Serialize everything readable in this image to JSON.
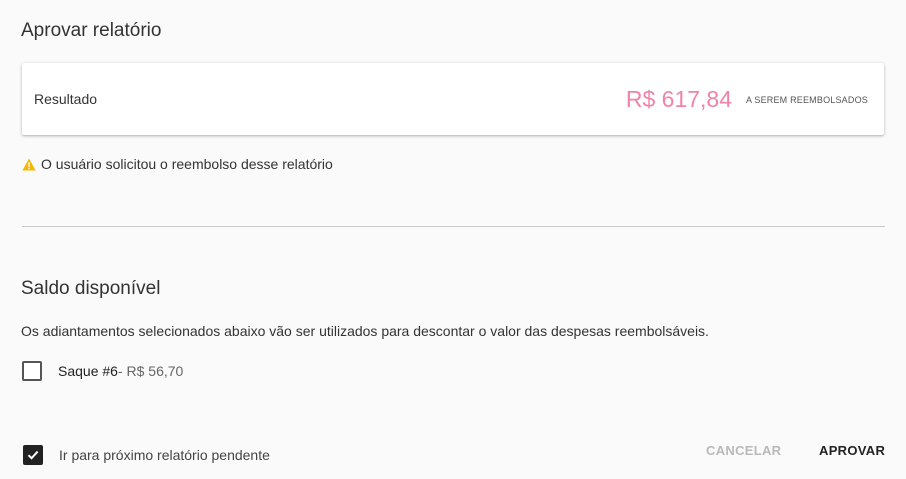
{
  "header": {
    "title": "Aprovar relatório"
  },
  "result": {
    "label": "Resultado",
    "amount": "R$ 617,84",
    "caption": "A SEREM REEMBOLSADOS",
    "amount_color": "#ee84a8"
  },
  "warning": {
    "icon": "warning-icon",
    "text": "O usuário solicitou o reembolso desse relatório",
    "icon_color": "#f5b800"
  },
  "balance": {
    "title": "Saldo disponível",
    "description": "Os adiantamentos selecionados abaixo vão ser utilizados para descontar o valor das despesas reembolsáveis.",
    "advances": [
      {
        "name": "Saque #6",
        "value": "- R$ 56,70",
        "checked": false
      }
    ]
  },
  "footer": {
    "next_pending_label": "Ir para próximo relatório pendente",
    "next_pending_checked": true,
    "cancel_label": "CANCELAR",
    "approve_label": "APROVAR"
  }
}
